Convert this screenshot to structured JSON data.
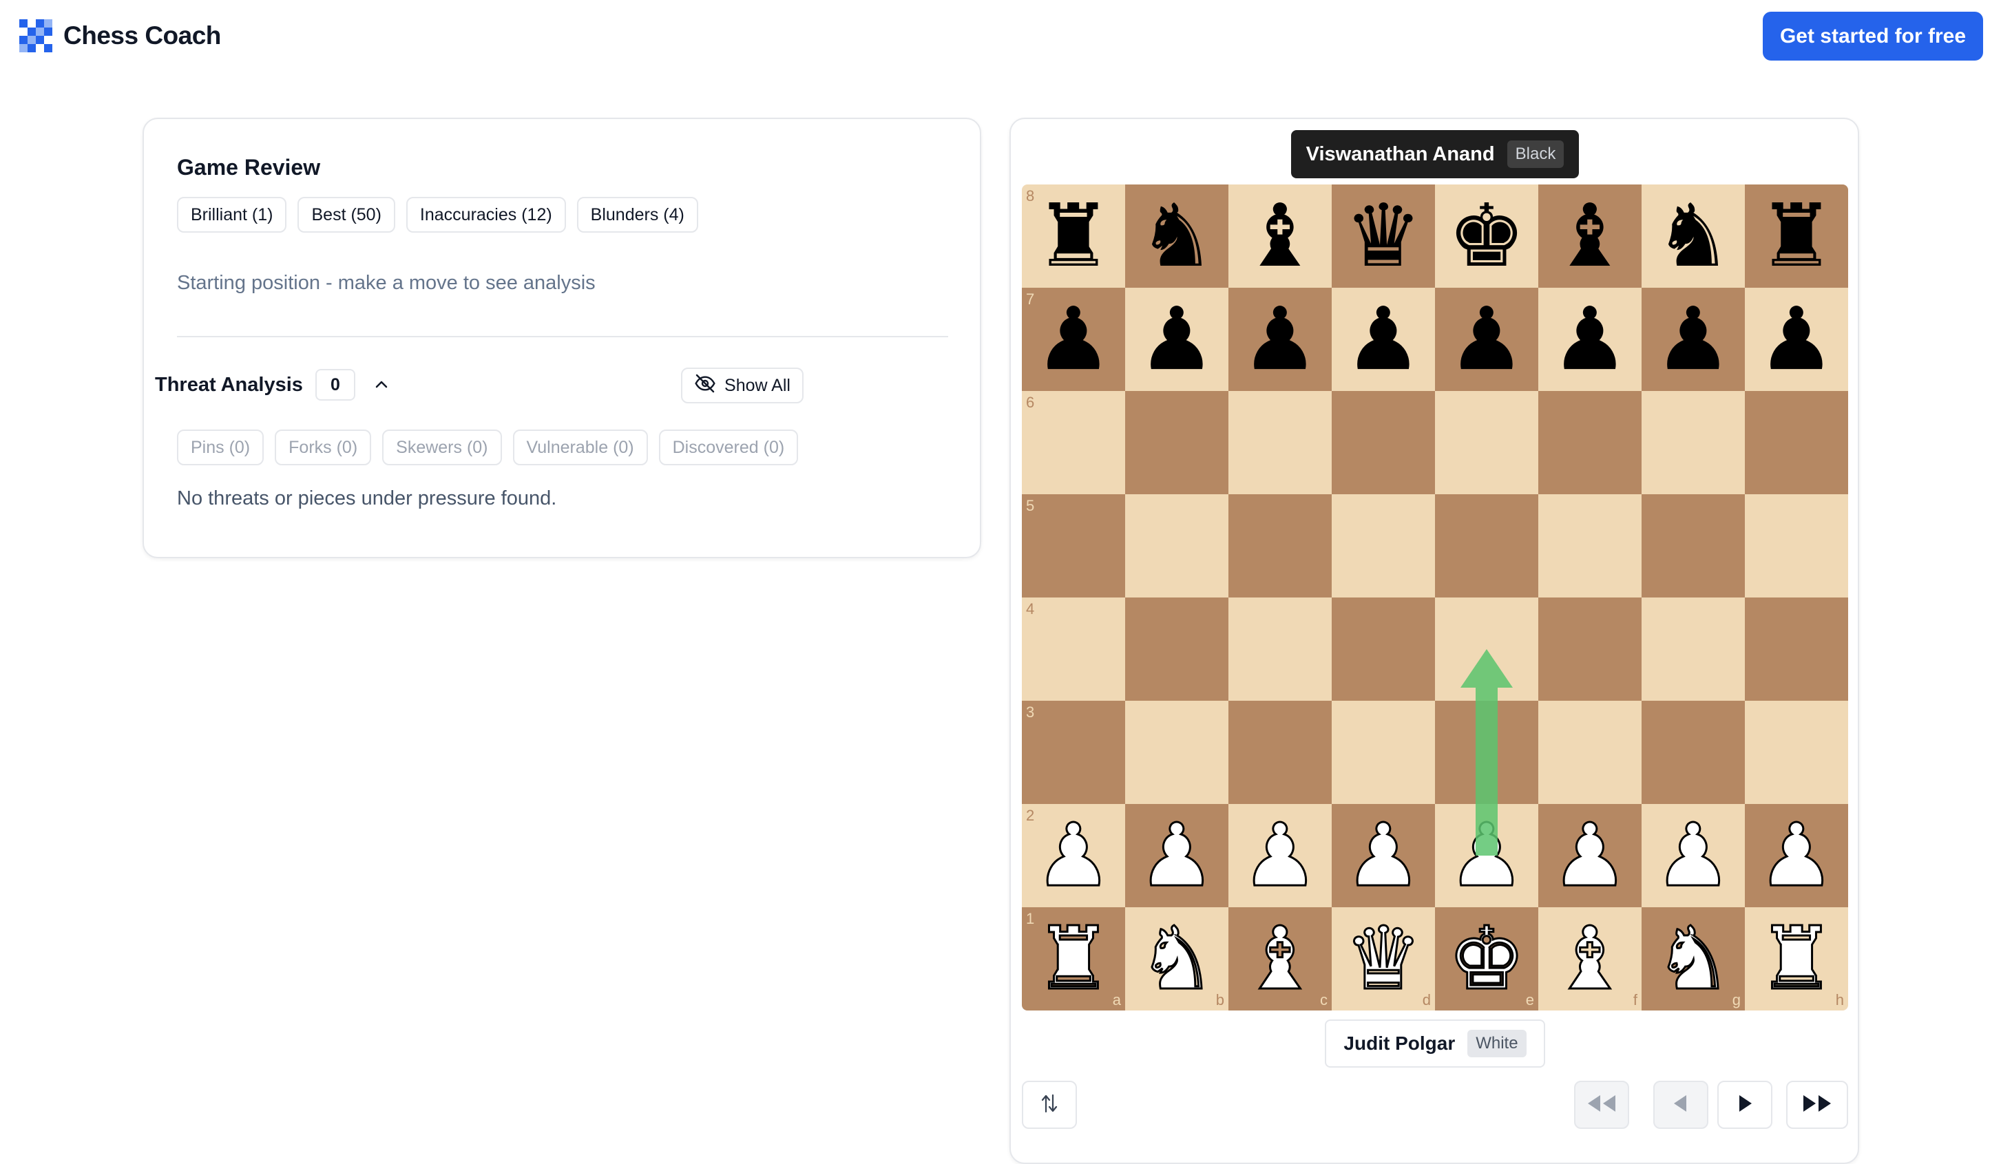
{
  "header": {
    "brand": "Chess Coach",
    "cta_label": "Get started for free",
    "accent_color": "#2563eb"
  },
  "review": {
    "title": "Game Review",
    "chips": [
      "Brilliant (1)",
      "Best (50)",
      "Inaccuracies (12)",
      "Blunders (4)"
    ],
    "status": "Starting position - make a move to see analysis"
  },
  "threats": {
    "title": "Threat Analysis",
    "count": "0",
    "show_all_label": "Show All",
    "chips": [
      "Pins (0)",
      "Forks (0)",
      "Skewers (0)",
      "Vulnerable (0)",
      "Discovered (0)"
    ],
    "empty_message": "No threats or pieces under pressure found."
  },
  "players": {
    "top": {
      "name": "Viswanathan Anand",
      "color": "Black"
    },
    "bottom": {
      "name": "Judit Polgar",
      "color": "White"
    }
  },
  "board": {
    "light_color": "#f0d9b5",
    "dark_color": "#b58863",
    "files": [
      "a",
      "b",
      "c",
      "d",
      "e",
      "f",
      "g",
      "h"
    ],
    "ranks": [
      "8",
      "7",
      "6",
      "5",
      "4",
      "3",
      "2",
      "1"
    ],
    "position": [
      [
        "bR",
        "bN",
        "bB",
        "bQ",
        "bK",
        "bB",
        "bN",
        "bR"
      ],
      [
        "bP",
        "bP",
        "bP",
        "bP",
        "bP",
        "bP",
        "bP",
        "bP"
      ],
      [
        "",
        "",
        "",
        "",
        "",
        "",
        "",
        ""
      ],
      [
        "",
        "",
        "",
        "",
        "",
        "",
        "",
        ""
      ],
      [
        "",
        "",
        "",
        "",
        "",
        "",
        "",
        ""
      ],
      [
        "",
        "",
        "",
        "",
        "",
        "",
        "",
        ""
      ],
      [
        "wP",
        "wP",
        "wP",
        "wP",
        "wP",
        "wP",
        "wP",
        "wP"
      ],
      [
        "wR",
        "wN",
        "wB",
        "wQ",
        "wK",
        "wB",
        "wN",
        "wR"
      ]
    ],
    "suggested_move": {
      "from": "e2",
      "to": "e4",
      "color": "#5cc46e"
    }
  },
  "controls": {
    "flip_icon": "flip-board-icon",
    "nav_icons": [
      "first-move-icon",
      "previous-move-icon",
      "next-move-icon",
      "last-move-icon"
    ]
  }
}
